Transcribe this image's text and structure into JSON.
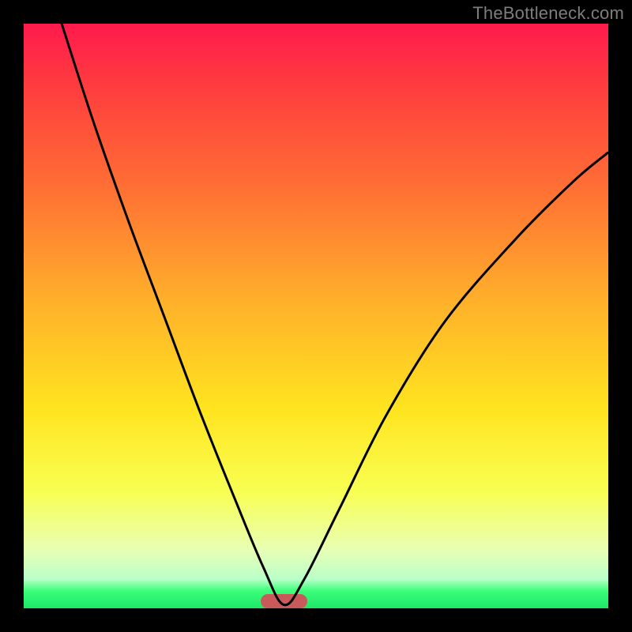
{
  "watermark": "TheBottleneck.com",
  "gradient": {
    "top_color": "#ff1a4d",
    "bottom_color": "#1de66a",
    "description": "red-orange-yellow-green vertical gradient"
  },
  "marker": {
    "color": "#c95a5a",
    "x_fraction_left": 0.405,
    "x_fraction_right": 0.485,
    "thickness_px": 18
  },
  "curve": {
    "stroke": "#000000",
    "stroke_width": 3,
    "left_top_x_fraction": 0.065,
    "cusp_x_fraction": 0.445,
    "cusp_y_fraction": 0.994,
    "right_endpoint_x_fraction": 1.0,
    "right_endpoint_y_fraction": 0.22
  },
  "chart_data": {
    "type": "line",
    "title": "",
    "xlabel": "",
    "ylabel": "",
    "xlim": [
      0,
      1
    ],
    "ylim": [
      0,
      1
    ],
    "series": [
      {
        "name": "bottleneck-curve",
        "x": [
          0.065,
          0.12,
          0.18,
          0.24,
          0.3,
          0.36,
          0.41,
          0.445,
          0.48,
          0.54,
          0.62,
          0.72,
          0.84,
          0.94,
          1.0
        ],
        "y": [
          1.0,
          0.83,
          0.66,
          0.5,
          0.34,
          0.19,
          0.07,
          0.006,
          0.05,
          0.17,
          0.33,
          0.49,
          0.63,
          0.73,
          0.78
        ]
      }
    ],
    "annotations": [
      {
        "name": "optimum-marker",
        "x_range": [
          0.405,
          0.485
        ],
        "y": 0.0,
        "color": "#c95a5a"
      }
    ]
  }
}
